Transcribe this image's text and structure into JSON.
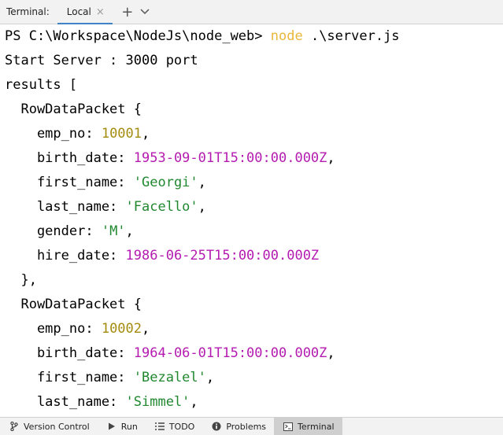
{
  "header": {
    "title": "Terminal:",
    "tabs": [
      {
        "label": "Local",
        "close": "×"
      }
    ],
    "new_tab": "+",
    "dropdown": "⌄"
  },
  "terminal": {
    "lines": [
      [
        {
          "t": "PS C:\\Workspace\\NodeJs\\node_web> "
        },
        {
          "t": "node",
          "c": "cmd"
        },
        {
          "t": " .\\server.js"
        }
      ],
      [
        {
          "t": "Start Server : 3000 port"
        }
      ],
      [
        {
          "t": "results ["
        }
      ],
      [
        {
          "t": "  RowDataPacket {"
        }
      ],
      [
        {
          "t": "    emp_no: "
        },
        {
          "t": "10001",
          "c": "num"
        },
        {
          "t": ","
        }
      ],
      [
        {
          "t": "    birth_date: "
        },
        {
          "t": "1953-09-01T15:00:00.000Z",
          "c": "date"
        },
        {
          "t": ","
        }
      ],
      [
        {
          "t": "    first_name: "
        },
        {
          "t": "'Georgi'",
          "c": "str"
        },
        {
          "t": ","
        }
      ],
      [
        {
          "t": "    last_name: "
        },
        {
          "t": "'Facello'",
          "c": "str"
        },
        {
          "t": ","
        }
      ],
      [
        {
          "t": "    gender: "
        },
        {
          "t": "'M'",
          "c": "str"
        },
        {
          "t": ","
        }
      ],
      [
        {
          "t": "    hire_date: "
        },
        {
          "t": "1986-06-25T15:00:00.000Z",
          "c": "date"
        }
      ],
      [
        {
          "t": "  },"
        }
      ],
      [
        {
          "t": "  RowDataPacket {"
        }
      ],
      [
        {
          "t": "    emp_no: "
        },
        {
          "t": "10002",
          "c": "num"
        },
        {
          "t": ","
        }
      ],
      [
        {
          "t": "    birth_date: "
        },
        {
          "t": "1964-06-01T15:00:00.000Z",
          "c": "date"
        },
        {
          "t": ","
        }
      ],
      [
        {
          "t": "    first_name: "
        },
        {
          "t": "'Bezalel'",
          "c": "str"
        },
        {
          "t": ","
        }
      ],
      [
        {
          "t": "    last_name: "
        },
        {
          "t": "'Simmel'",
          "c": "str"
        },
        {
          "t": ","
        }
      ]
    ]
  },
  "toolbar": {
    "items": [
      {
        "label": "Version Control",
        "icon": "branch-icon",
        "active": false
      },
      {
        "label": "Run",
        "icon": "play-icon",
        "active": false
      },
      {
        "label": "TODO",
        "icon": "list-icon",
        "active": false
      },
      {
        "label": "Problems",
        "icon": "info-icon",
        "active": false
      },
      {
        "label": "Terminal",
        "icon": "terminal-icon",
        "active": true
      }
    ]
  },
  "colors": {
    "command": "#e9b83a",
    "number": "#a48b0e",
    "date": "#b41bb0",
    "string": "#21882f",
    "tab_underline": "#4083c9"
  }
}
